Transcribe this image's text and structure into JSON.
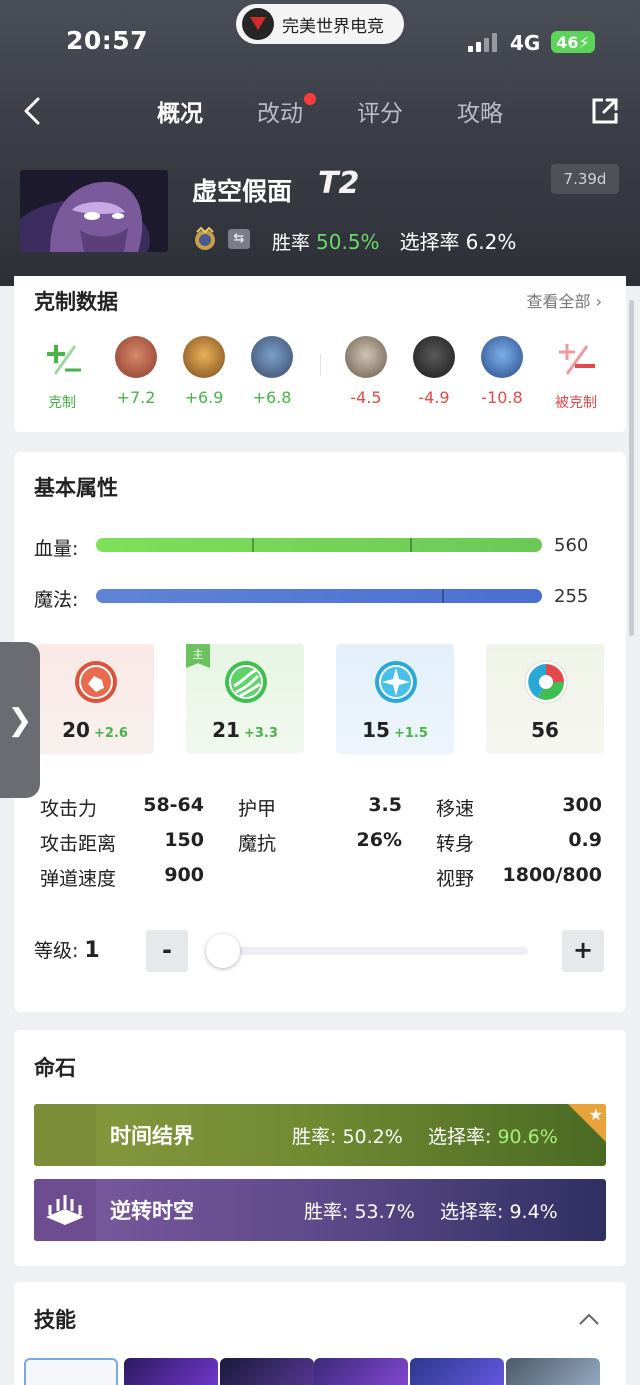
{
  "status_bar": {
    "time": "20:57",
    "app_name": "完美世界电竞",
    "network": "4G",
    "battery": "46"
  },
  "nav": {
    "tabs": [
      {
        "label": "概况",
        "active": true
      },
      {
        "label": "改动",
        "has_dot": true
      },
      {
        "label": "评分"
      },
      {
        "label": "攻略"
      }
    ]
  },
  "hero": {
    "name": "虚空假面",
    "tier": "T2",
    "patch": "7.39d",
    "win_rate_label": "胜率",
    "win_rate": "50.5%",
    "pick_rate_label": "选择率",
    "pick_rate": "6.2%"
  },
  "counters": {
    "title": "克制数据",
    "see_all": "查看全部",
    "counter_label": "克制",
    "countered_label": "被克制",
    "positive": [
      "+7.2",
      "+6.9",
      "+6.8"
    ],
    "negative": [
      "-4.5",
      "-4.9",
      "-10.8"
    ]
  },
  "attributes": {
    "title": "基本属性",
    "hp_label": "血量:",
    "hp": "560",
    "mana_label": "魔法:",
    "mana": "255",
    "main_tag": "主",
    "strength": {
      "base": "20",
      "gain": "+2.6"
    },
    "agility": {
      "base": "21",
      "gain": "+3.3"
    },
    "intelligence": {
      "base": "15",
      "gain": "+1.5"
    },
    "universal": {
      "base": "56"
    },
    "stats": [
      {
        "k1": "攻击力",
        "v1": "58-64",
        "k2": "护甲",
        "v2": "3.5",
        "k3": "移速",
        "v3": "300"
      },
      {
        "k1": "攻击距离",
        "v1": "150",
        "k2": "魔抗",
        "v2": "26%",
        "k3": "转身",
        "v3": "0.9"
      },
      {
        "k1": "弹道速度",
        "v1": "900",
        "k2": "",
        "v2": "",
        "k3": "视野",
        "v3": "1800/800"
      }
    ],
    "level_label": "等级:",
    "level": "1",
    "minus": "-",
    "plus": "+"
  },
  "facets": {
    "title": "命石",
    "items": [
      {
        "name": "时间结界",
        "win_label": "胜率:",
        "win": "50.2%",
        "pick_label": "选择率:",
        "pick": "90.6%"
      },
      {
        "name": "逆转时空",
        "win_label": "胜率:",
        "win": "53.7%",
        "pick_label": "选择率:",
        "pick": "9.4%"
      }
    ]
  },
  "skills": {
    "title": "技能"
  },
  "colors": {
    "positive": "#4ab34a",
    "negative": "#e04a4a",
    "highlight": "#6bd86b",
    "facet_star": "#e8a43a"
  }
}
